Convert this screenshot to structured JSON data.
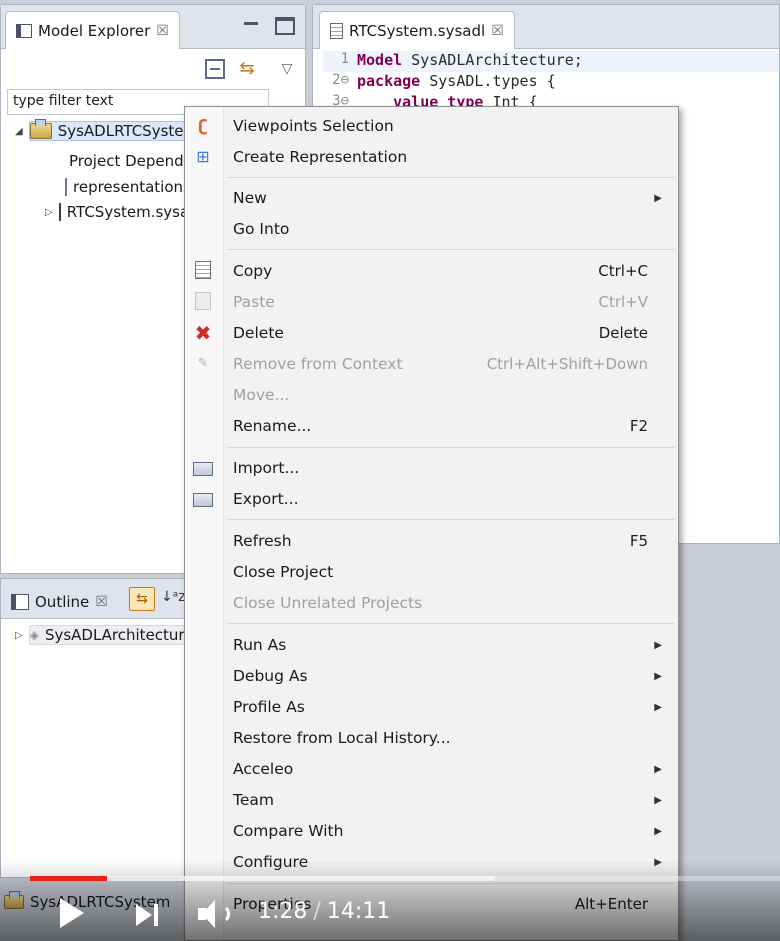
{
  "explorer": {
    "tab_label": "Model Explorer",
    "filter_placeholder": "type filter text",
    "tree": [
      {
        "label": "SysADLRTCSystem",
        "kind": "project",
        "expanded": true
      },
      {
        "label": "Project Dependencies",
        "kind": "dependencies"
      },
      {
        "label": "representations.aird",
        "kind": "file"
      },
      {
        "label": "RTCSystem.sysadl",
        "kind": "sysadl",
        "expanded": false
      }
    ]
  },
  "outline": {
    "tab_label": "Outline",
    "item_label": "SysADLArchitecture"
  },
  "editor": {
    "tab_label": "RTCSystem.sysadl",
    "lines": [
      {
        "num": "1",
        "keyword": "Model",
        "rest": " SysADLArchitecture;"
      },
      {
        "num": "2⊖",
        "keyword": "package",
        "rest": " SysADL.types {"
      },
      {
        "num": "3⊖",
        "keyword": "    value type",
        "rest": " Int {"
      }
    ]
  },
  "context_menu": {
    "items": [
      {
        "label": "Viewpoints Selection",
        "icon": "viewpoint-icon",
        "enabled": true
      },
      {
        "label": "Create Representation",
        "icon": "create-representation-icon",
        "enabled": true
      },
      {
        "label": "New",
        "submenu": true,
        "enabled": true
      },
      {
        "label": "Go Into",
        "enabled": true
      },
      {
        "label": "Copy",
        "shortcut": "Ctrl+C",
        "icon": "copy-icon",
        "enabled": true
      },
      {
        "label": "Paste",
        "shortcut": "Ctrl+V",
        "icon": "paste-icon",
        "enabled": false
      },
      {
        "label": "Delete",
        "shortcut": "Delete",
        "icon": "delete-icon",
        "enabled": true
      },
      {
        "label": "Remove from Context",
        "shortcut": "Ctrl+Alt+Shift+Down",
        "icon": "remove-context-icon",
        "enabled": false
      },
      {
        "label": "Move...",
        "enabled": false
      },
      {
        "label": "Rename...",
        "shortcut": "F2",
        "enabled": true
      },
      {
        "label": "Import...",
        "icon": "import-icon",
        "enabled": true
      },
      {
        "label": "Export...",
        "icon": "export-icon",
        "enabled": true
      },
      {
        "label": "Refresh",
        "shortcut": "F5",
        "enabled": true
      },
      {
        "label": "Close Project",
        "enabled": true
      },
      {
        "label": "Close Unrelated Projects",
        "enabled": false
      },
      {
        "label": "Run As",
        "submenu": true,
        "enabled": true
      },
      {
        "label": "Debug As",
        "submenu": true,
        "enabled": true
      },
      {
        "label": "Profile As",
        "submenu": true,
        "enabled": true
      },
      {
        "label": "Restore from Local History...",
        "enabled": true
      },
      {
        "label": "Acceleo",
        "submenu": true,
        "enabled": true
      },
      {
        "label": "Team",
        "submenu": true,
        "enabled": true
      },
      {
        "label": "Compare With",
        "submenu": true,
        "enabled": true
      },
      {
        "label": "Configure",
        "submenu": true,
        "enabled": true
      },
      {
        "label": "Properties",
        "shortcut": "Alt+Enter",
        "enabled": true
      }
    ]
  },
  "status_bar": {
    "selected_label": "SysADLRTCSystem"
  },
  "video_player": {
    "current_time": "1:28",
    "separator": "/",
    "duration": "14:11",
    "played_fraction": 0.103,
    "buffered_fraction": 0.62,
    "progress_color": "#e62117"
  },
  "colors": {
    "keyword": "#7f0055",
    "selection": "#dbe8fa",
    "menu_bg": "#f2f2f2",
    "disabled_text": "#a0a0a0"
  }
}
